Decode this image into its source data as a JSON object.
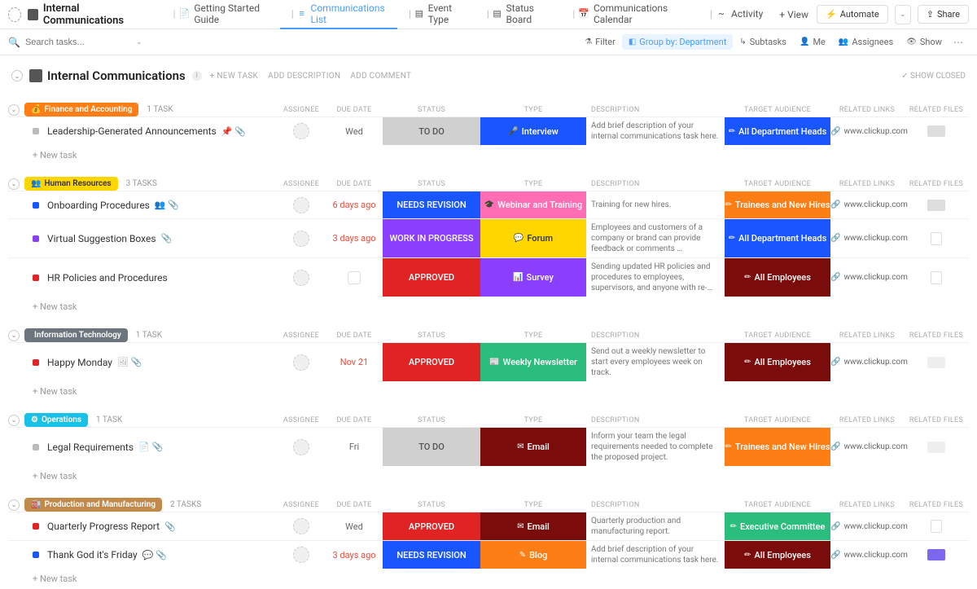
{
  "workspace": {
    "name": "Internal Communications"
  },
  "tabs": [
    {
      "prefix": "",
      "label": "Getting Started Guide",
      "active": false,
      "icon": "doc"
    },
    {
      "prefix": "",
      "label": "Communications List",
      "active": true,
      "icon": "list"
    },
    {
      "prefix": "",
      "label": "Event Type",
      "active": false,
      "icon": "board"
    },
    {
      "prefix": "",
      "label": "Status Board",
      "active": false,
      "icon": "board"
    },
    {
      "prefix": "",
      "label": "Communications Calendar",
      "active": false,
      "icon": "calendar"
    },
    {
      "prefix": "",
      "label": "Activity",
      "active": false,
      "icon": "activity"
    }
  ],
  "add_view": "View",
  "automate": "Automate",
  "share": "Share",
  "search_placeholder": "Search tasks...",
  "filters": {
    "filter": "Filter",
    "group_by": "Group by: Department",
    "subtasks": "Subtasks",
    "me": "Me",
    "assignees": "Assignees",
    "show": "Show"
  },
  "header": {
    "title": "Internal Communications",
    "new_task": "+ NEW TASK",
    "add_desc": "ADD DESCRIPTION",
    "add_comment": "ADD COMMENT",
    "show_closed": "SHOW CLOSED"
  },
  "column_labels": {
    "assignee": "ASSIGNEE",
    "due": "DUE DATE",
    "status": "STATUS",
    "type": "TYPE",
    "desc": "DESCRIPTION",
    "aud": "TARGET AUDIENCE",
    "link": "RELATED LINKS",
    "files": "RELATED FILES"
  },
  "new_task_label": "+ New task",
  "groups": [
    {
      "name": "Finance and Accounting",
      "color": "#fd7e14",
      "icon": "💰",
      "count": "1 TASK",
      "tasks": [
        {
          "name": "Leadership-Generated Announcements",
          "dot": "#bbb",
          "extras": "📌 📎",
          "due": "Wed",
          "overdue": false,
          "status": {
            "t": "TO DO",
            "bg": "#d0d0d0",
            "fg": "#555"
          },
          "type": {
            "t": "Interview",
            "bg": "#1a56ff",
            "fg": "#fff",
            "i": "🎤"
          },
          "desc": "Add brief description of your internal communications task here.",
          "aud": {
            "t": "All Department Heads",
            "bg": "#1a56ff",
            "fg": "#fff",
            "i": "✏"
          },
          "link": "www.clickup.com",
          "file": "img"
        }
      ]
    },
    {
      "name": "Human Resources",
      "color": "#ffd600",
      "icon": "👥",
      "fg": "#333",
      "count": "3 TASKS",
      "tasks": [
        {
          "name": "Onboarding Procedures",
          "dot": "#1a56ff",
          "extras": "👥 📎",
          "due": "6 days ago",
          "overdue": true,
          "status": {
            "t": "NEEDS REVISION",
            "bg": "#1a56ff",
            "fg": "#fff"
          },
          "type": {
            "t": "Webinar and Training",
            "bg": "#ff6eb4",
            "fg": "#fff",
            "i": "🎓"
          },
          "desc": "Training for new hires.",
          "aud": {
            "t": "Trainees and New Hires",
            "bg": "#fd7e14",
            "fg": "#fff",
            "i": "✏"
          },
          "link": "www.clickup.com",
          "file": "img"
        },
        {
          "name": "Virtual Suggestion Boxes",
          "dot": "#8a3ffc",
          "extras": "📎",
          "due": "3 days ago",
          "overdue": true,
          "status": {
            "t": "WORK IN PROGRESS",
            "bg": "#8a3ffc",
            "fg": "#fff"
          },
          "type": {
            "t": "Forum",
            "bg": "#ffd600",
            "fg": "#333",
            "i": "💬"
          },
          "desc": "Employees and customers of a company or brand can provide feedback or comments …",
          "aud": {
            "t": "All Department Heads",
            "bg": "#1a56ff",
            "fg": "#fff",
            "i": "✏"
          },
          "link": "www.clickup.com",
          "file": "doc"
        },
        {
          "name": "HR Policies and Procedures",
          "dot": "#e02424",
          "extras": "",
          "due": "",
          "overdue": false,
          "due_placeholder": true,
          "status": {
            "t": "APPROVED",
            "bg": "#e02424",
            "fg": "#fff"
          },
          "type": {
            "t": "Survey",
            "bg": "#8a3ffc",
            "fg": "#fff",
            "i": "📊"
          },
          "desc": "Sending updated HR policies and procedures to employees, supervisors, and anyone with re-…",
          "aud": {
            "t": "All Employees",
            "bg": "#7a0c0c",
            "fg": "#fff",
            "i": "✏"
          },
          "link": "www.clickup.com",
          "file": "doc"
        }
      ]
    },
    {
      "name": "Information Technology",
      "color": "#6c757d",
      "icon": "",
      "count": "1 TASK",
      "tasks": [
        {
          "name": "Happy Monday",
          "dot": "#e02424",
          "extras": "🖼 📎",
          "due": "Nov 21",
          "overdue": true,
          "status": {
            "t": "APPROVED",
            "bg": "#e02424",
            "fg": "#fff"
          },
          "type": {
            "t": "Weekly Newsletter",
            "bg": "#2bbd7e",
            "fg": "#fff",
            "i": "📰"
          },
          "desc": "Send out a weekly newsletter to start every employees week on track.",
          "aud": {
            "t": "All Employees",
            "bg": "#7a0c0c",
            "fg": "#fff",
            "i": "✏"
          },
          "link": "www.clickup.com",
          "file": "img-gray"
        }
      ]
    },
    {
      "name": "Operations",
      "color": "#17c1e8",
      "icon": "⚙",
      "count": "1 TASK",
      "tasks": [
        {
          "name": "Legal Requirements",
          "dot": "#bbb",
          "extras": "📄 📎",
          "due": "Fri",
          "overdue": false,
          "status": {
            "t": "TO DO",
            "bg": "#d0d0d0",
            "fg": "#555"
          },
          "type": {
            "t": "Email",
            "bg": "#7a0c0c",
            "fg": "#fff",
            "i": "✉"
          },
          "desc": "Inform your team the legal requirements needed to complete the proposed project.",
          "aud": {
            "t": "Trainees and New Hires",
            "bg": "#fd7e14",
            "fg": "#fff",
            "i": "✏"
          },
          "link": "www.clickup.com",
          "file": "img-gray"
        }
      ]
    },
    {
      "name": "Production and Manufacturing",
      "color": "#c28a4a",
      "icon": "🏭",
      "count": "2 TASKS",
      "tasks": [
        {
          "name": "Quarterly Progress Report",
          "dot": "#e02424",
          "extras": "📎",
          "due": "Wed",
          "overdue": false,
          "status": {
            "t": "APPROVED",
            "bg": "#e02424",
            "fg": "#fff"
          },
          "type": {
            "t": "Email",
            "bg": "#7a0c0c",
            "fg": "#fff",
            "i": "✉"
          },
          "desc": "Quarterly production and manufacturing report.",
          "aud": {
            "t": "Executive Committee",
            "bg": "#2bbd7e",
            "fg": "#fff",
            "i": "✏"
          },
          "link": "www.clickup.com",
          "file": "doc"
        },
        {
          "name": "Thank God it's Friday",
          "dot": "#1a56ff",
          "extras": "💬 📎",
          "due": "3 days ago",
          "overdue": true,
          "status": {
            "t": "NEEDS REVISION",
            "bg": "#1a56ff",
            "fg": "#fff"
          },
          "type": {
            "t": "Blog",
            "bg": "#fd7e14",
            "fg": "#fff",
            "i": "✎"
          },
          "desc": "Add brief description of your internal communications task here.",
          "aud": {
            "t": "All Employees",
            "bg": "#7a0c0c",
            "fg": "#fff",
            "i": "✏"
          },
          "link": "www.clickup.com",
          "file": "purple"
        }
      ]
    }
  ]
}
